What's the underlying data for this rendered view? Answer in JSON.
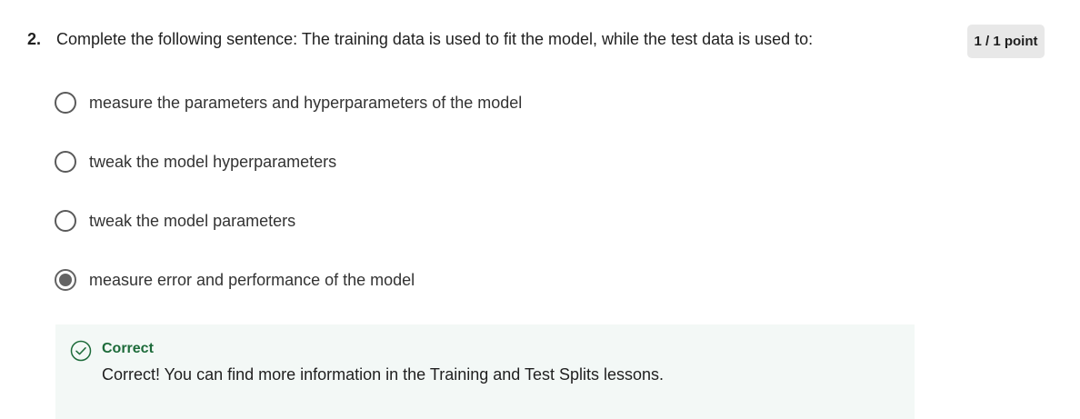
{
  "question": {
    "number": "2.",
    "text": "Complete the following sentence: The training data is used to fit the model, while the test data is used to:",
    "points": "1 / 1 point"
  },
  "options": [
    {
      "label": "measure the parameters and hyperparameters of the model",
      "selected": false
    },
    {
      "label": "tweak the model hyperparameters",
      "selected": false
    },
    {
      "label": "tweak the model parameters",
      "selected": false
    },
    {
      "label": "measure error and performance of the model",
      "selected": true
    }
  ],
  "feedback": {
    "icon": "check-circle-icon",
    "status": "Correct",
    "message": "Correct! You can find more information in the Training and Test Splits lessons.",
    "color": "#1d6b3a"
  }
}
